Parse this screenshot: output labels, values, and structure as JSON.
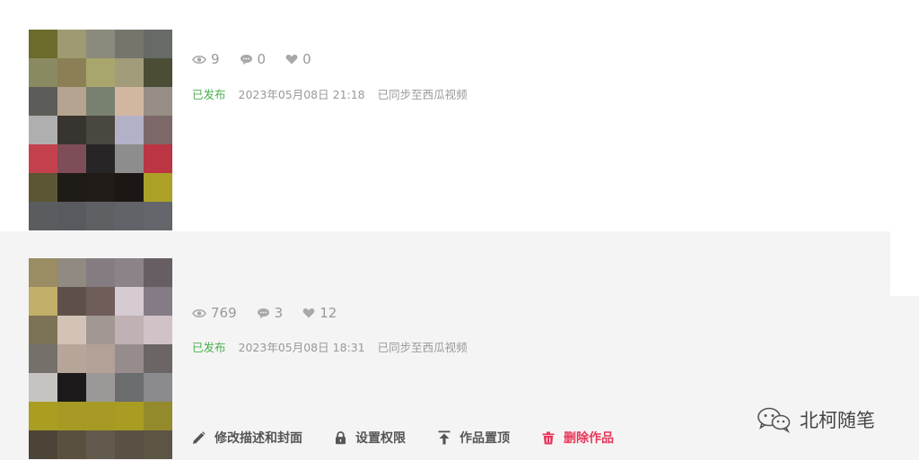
{
  "posts": [
    {
      "stats": {
        "views": "9",
        "comments": "0",
        "likes": "0"
      },
      "status": "已发布",
      "date": "2023年05月08日 21:18",
      "sync": "已同步至西瓜视频",
      "thumb_colors": [
        "#6b6c2c",
        "#9e9a72",
        "#8c8a7d",
        "#75756c",
        "#676b66",
        "#8a8a62",
        "#8b7f55",
        "#a8a66c",
        "#a39c7a",
        "#4b4d35",
        "#5c5c58",
        "#b5a590",
        "#788070",
        "#d2b7a0",
        "#978e85",
        "#afafaf",
        "#383430",
        "#4a4741",
        "#b3b1c8",
        "#7d6869",
        "#c3414d",
        "#7e4d58",
        "#272525",
        "#8d8d8d",
        "#bb3545",
        "#5c5634",
        "#1f1b17",
        "#221c18",
        "#1c1714",
        "#aba126",
        "#5b5c5f",
        "#585a5f",
        "#5f6063",
        "#626368",
        "#64666b"
      ]
    },
    {
      "stats": {
        "views": "769",
        "comments": "3",
        "likes": "12"
      },
      "status": "已发布",
      "date": "2023年05月08日 18:31",
      "sync": "已同步至西瓜视频",
      "thumb_colors": [
        "#9a8d64",
        "#918a80",
        "#857c82",
        "#8c8289",
        "#675e63",
        "#c2af68",
        "#5e5048",
        "#6f5d5a",
        "#d6cbd3",
        "#857b86",
        "#7c7256",
        "#d3c3b7",
        "#a29893",
        "#c0b1b5",
        "#d1c2c7",
        "#76706a",
        "#b6a69a",
        "#b2a197",
        "#968c8c",
        "#6c6565",
        "#c7c3c1",
        "#1d1a1b",
        "#9c9898",
        "#6c6d6f",
        "#8b8a8c",
        "#a99d22",
        "#a79a24",
        "#a69a25",
        "#a89c22",
        "#948a2c",
        "#4c4436",
        "#5a503f",
        "#625a4c",
        "#5a5145",
        "#5c5445"
      ]
    }
  ],
  "actions": {
    "edit": "修改描述和封面",
    "permissions": "设置权限",
    "pin": "作品置顶",
    "delete": "删除作品"
  },
  "watermark": "北柯随笔",
  "colors": {
    "status_green": "#4caf50",
    "danger_red": "#e8365a",
    "muted_gray": "#999999"
  },
  "icons": [
    "eye-icon",
    "comment-icon",
    "heart-icon",
    "pencil-icon",
    "lock-icon",
    "pin-top-icon",
    "trash-icon",
    "wechat-icon"
  ]
}
